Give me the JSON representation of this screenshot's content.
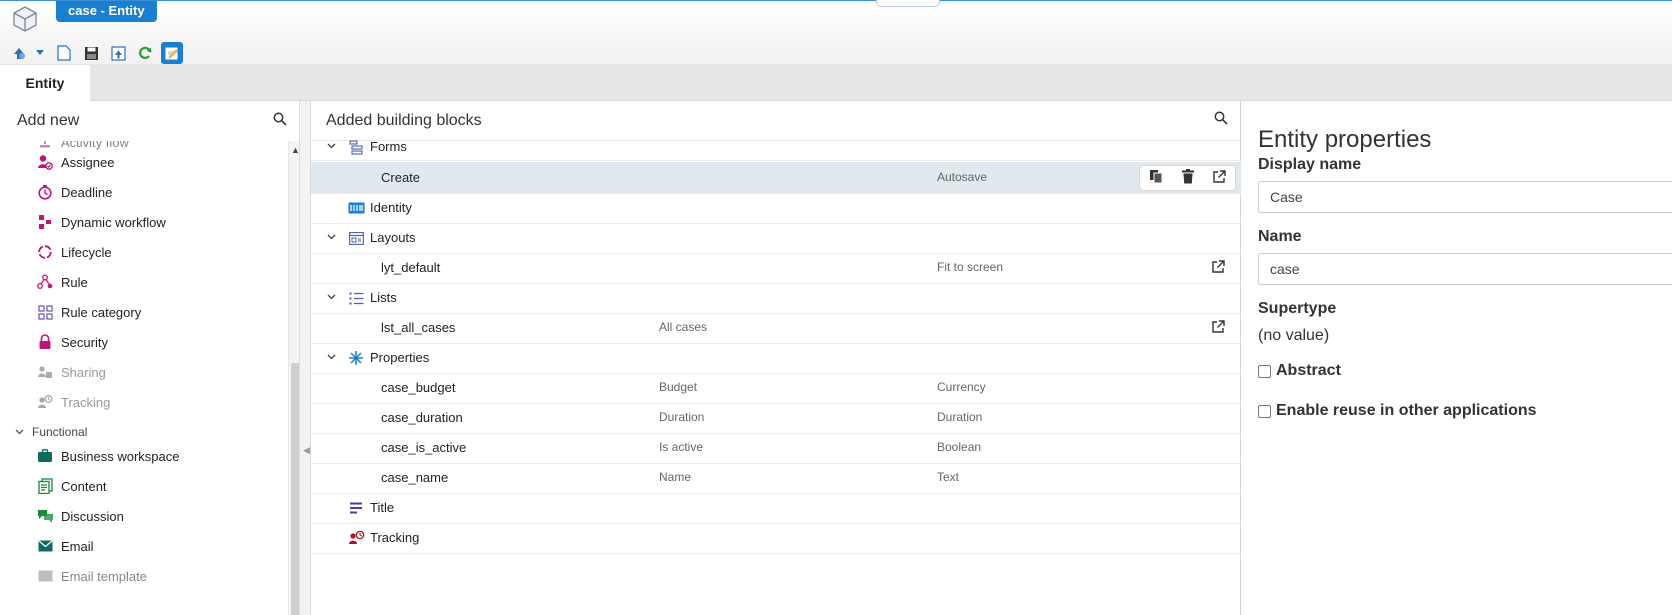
{
  "window": {
    "title_tab": "case - Entity"
  },
  "toolbar": {
    "buttons": [
      "publish-icon",
      "dropdown-arrow-icon",
      "new-document-icon",
      "save-icon",
      "export-icon",
      "refresh-icon",
      "edit-mode-icon"
    ]
  },
  "tabs": {
    "entity": "Entity"
  },
  "left_panel": {
    "header": "Add new",
    "items_top": [
      {
        "label": "Activity flow",
        "icon": "activity-flow-icon"
      },
      {
        "label": "Assignee",
        "icon": "assignee-icon"
      },
      {
        "label": "Deadline",
        "icon": "deadline-icon"
      },
      {
        "label": "Dynamic workflow",
        "icon": "dynamic-workflow-icon"
      },
      {
        "label": "Lifecycle",
        "icon": "lifecycle-icon"
      },
      {
        "label": "Rule",
        "icon": "rule-icon"
      },
      {
        "label": "Rule category",
        "icon": "rule-category-icon"
      },
      {
        "label": "Security",
        "icon": "lock-icon"
      },
      {
        "label": "Sharing",
        "icon": "sharing-icon"
      },
      {
        "label": "Tracking",
        "icon": "tracking-icon"
      }
    ],
    "category_functional": "Functional",
    "items_functional": [
      {
        "label": "Business workspace",
        "icon": "briefcase-icon"
      },
      {
        "label": "Content",
        "icon": "content-icon"
      },
      {
        "label": "Discussion",
        "icon": "discussion-icon"
      },
      {
        "label": "Email",
        "icon": "email-icon"
      },
      {
        "label": "Email template",
        "icon": "email-template-icon"
      }
    ]
  },
  "middle_panel": {
    "header": "Added building blocks",
    "groups": {
      "forms": "Forms",
      "identity": "Identity",
      "layouts": "Layouts",
      "lists": "Lists",
      "properties": "Properties",
      "title": "Title",
      "tracking": "Tracking"
    },
    "items": {
      "create": {
        "name": "Create",
        "desc": "",
        "type": "Autosave"
      },
      "lyt_default": {
        "name": "lyt_default",
        "desc": "",
        "type": "Fit to screen"
      },
      "lst_all_cases": {
        "name": "lst_all_cases",
        "desc": "All cases",
        "type": ""
      },
      "case_budget": {
        "name": "case_budget",
        "desc": "Budget",
        "type": "Currency"
      },
      "case_duration": {
        "name": "case_duration",
        "desc": "Duration",
        "type": "Duration"
      },
      "case_is_active": {
        "name": "case_is_active",
        "desc": "Is active",
        "type": "Boolean"
      },
      "case_name": {
        "name": "case_name",
        "desc": "Name",
        "type": "Text"
      }
    }
  },
  "right_panel": {
    "title": "Entity properties",
    "display_name_label": "Display name",
    "display_name_value": "Case",
    "name_label": "Name",
    "name_value": "case",
    "supertype_label": "Supertype",
    "supertype_value": "(no value)",
    "abstract_label": "Abstract",
    "abstract_checked": false,
    "reuse_label": "Enable reuse in other applications",
    "reuse_checked": false
  },
  "colors": {
    "accent": "#1a7fd1",
    "selected_row": "#e1e9ef",
    "magenta_icon": "#c0147a",
    "green_icon": "#1a8a3a"
  }
}
